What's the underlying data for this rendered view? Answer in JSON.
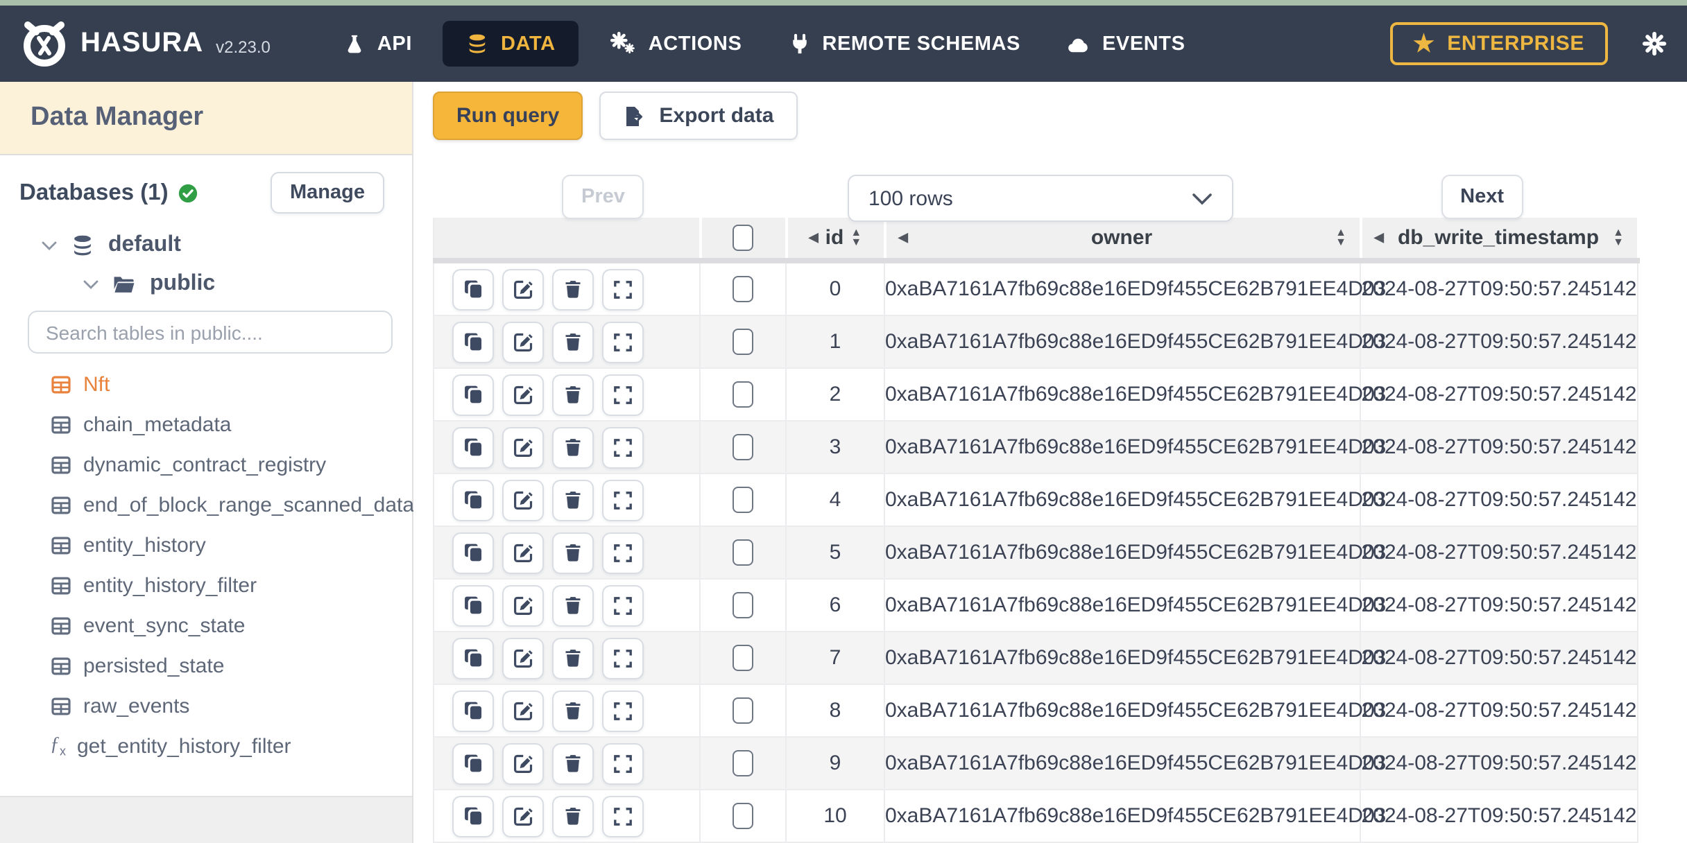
{
  "topbar": {
    "brand": {
      "name": "HASURA",
      "version": "v2.23.0"
    },
    "nav": [
      {
        "label": "API"
      },
      {
        "label": "DATA"
      },
      {
        "label": "ACTIONS"
      },
      {
        "label": "REMOTE SCHEMAS"
      },
      {
        "label": "EVENTS"
      }
    ],
    "enterprise_label": "ENTERPRISE"
  },
  "sidebar": {
    "title": "Data Manager",
    "databases_label": "Databases (1)",
    "manage_label": "Manage",
    "database_name": "default",
    "schema_name": "public",
    "search_placeholder": "Search tables in public....",
    "tables": [
      {
        "label": "Nft",
        "type": "table",
        "active": true
      },
      {
        "label": "chain_metadata",
        "type": "table",
        "active": false
      },
      {
        "label": "dynamic_contract_registry",
        "type": "table",
        "active": false
      },
      {
        "label": "end_of_block_range_scanned_data",
        "type": "table",
        "active": false
      },
      {
        "label": "entity_history",
        "type": "table",
        "active": false
      },
      {
        "label": "entity_history_filter",
        "type": "table",
        "active": false
      },
      {
        "label": "event_sync_state",
        "type": "table",
        "active": false
      },
      {
        "label": "persisted_state",
        "type": "table",
        "active": false
      },
      {
        "label": "raw_events",
        "type": "table",
        "active": false
      },
      {
        "label": "get_entity_history_filter",
        "type": "function",
        "active": false
      }
    ]
  },
  "toolbar": {
    "run_query_label": "Run query",
    "export_label": "Export data"
  },
  "pagination": {
    "prev_label": "Prev",
    "rows_value": "100 rows",
    "next_label": "Next"
  },
  "table": {
    "columns": [
      "id",
      "owner",
      "db_write_timestamp"
    ],
    "rows": [
      {
        "id": "0",
        "owner": "0xaBA7161A7fb69c88e16ED9f455CE62B791EE4D03",
        "db_write_timestamp": "2024-08-27T09:50:57.245142"
      },
      {
        "id": "1",
        "owner": "0xaBA7161A7fb69c88e16ED9f455CE62B791EE4D03",
        "db_write_timestamp": "2024-08-27T09:50:57.245142"
      },
      {
        "id": "2",
        "owner": "0xaBA7161A7fb69c88e16ED9f455CE62B791EE4D03",
        "db_write_timestamp": "2024-08-27T09:50:57.245142"
      },
      {
        "id": "3",
        "owner": "0xaBA7161A7fb69c88e16ED9f455CE62B791EE4D03",
        "db_write_timestamp": "2024-08-27T09:50:57.245142"
      },
      {
        "id": "4",
        "owner": "0xaBA7161A7fb69c88e16ED9f455CE62B791EE4D03",
        "db_write_timestamp": "2024-08-27T09:50:57.245142"
      },
      {
        "id": "5",
        "owner": "0xaBA7161A7fb69c88e16ED9f455CE62B791EE4D03",
        "db_write_timestamp": "2024-08-27T09:50:57.245142"
      },
      {
        "id": "6",
        "owner": "0xaBA7161A7fb69c88e16ED9f455CE62B791EE4D03",
        "db_write_timestamp": "2024-08-27T09:50:57.245142"
      },
      {
        "id": "7",
        "owner": "0xaBA7161A7fb69c88e16ED9f455CE62B791EE4D03",
        "db_write_timestamp": "2024-08-27T09:50:57.245142"
      },
      {
        "id": "8",
        "owner": "0xaBA7161A7fb69c88e16ED9f455CE62B791EE4D03",
        "db_write_timestamp": "2024-08-27T09:50:57.245142"
      },
      {
        "id": "9",
        "owner": "0xaBA7161A7fb69c88e16ED9f455CE62B791EE4D03",
        "db_write_timestamp": "2024-08-27T09:50:57.245142"
      },
      {
        "id": "10",
        "owner": "0xaBA7161A7fb69c88e16ED9f455CE62B791EE4D03",
        "db_write_timestamp": "2024-08-27T09:50:57.245142"
      }
    ]
  },
  "colors": {
    "topbar_bg": "#363f50",
    "top_strip": "#a9bfa9",
    "active_tab_bg": "#141b2b",
    "accent_yellow": "#f5b63a",
    "enterprise_gold": "#edb741",
    "active_table_orange": "#e8823c",
    "connected_green": "#2f9e44",
    "sidebar_header_bg": "#fcf2d9"
  }
}
